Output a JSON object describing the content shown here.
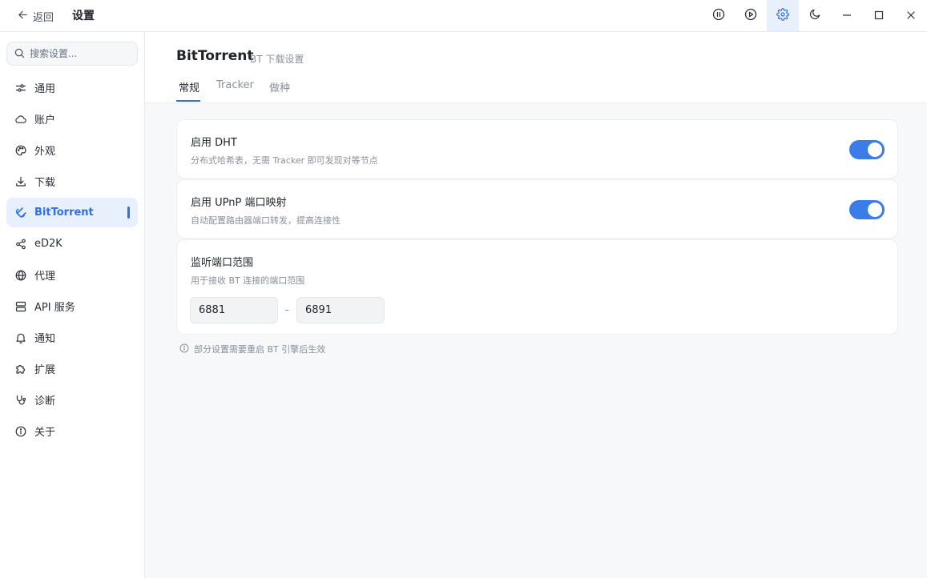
{
  "titlebar": {
    "back_label": "返回",
    "title": "设置",
    "active_button": "settings",
    "buttons": [
      "pause",
      "play",
      "settings",
      "theme-moon",
      "minimize",
      "maximize",
      "close"
    ]
  },
  "sidebar": {
    "search_placeholder": "搜索设置...",
    "items": [
      {
        "label": "通用",
        "icon": "sliders-icon"
      },
      {
        "label": "账户",
        "icon": "cloud-icon"
      },
      {
        "label": "外观",
        "icon": "palette-icon"
      },
      {
        "label": "下载",
        "icon": "download-icon"
      },
      {
        "label": "BitTorrent",
        "icon": "magnet-icon",
        "active": true
      },
      {
        "label": "eD2K",
        "icon": "share-icon"
      },
      {
        "label": "代理",
        "icon": "globe-icon"
      },
      {
        "label": "API 服务",
        "icon": "server-icon"
      },
      {
        "label": "通知",
        "icon": "bell-icon"
      },
      {
        "label": "扩展",
        "icon": "puzzle-icon"
      },
      {
        "label": "诊断",
        "icon": "stethoscope-icon"
      },
      {
        "label": "关于",
        "icon": "info-icon"
      }
    ]
  },
  "main": {
    "title": "BitTorrent",
    "subtitle": "BT 下载设置",
    "tabs": [
      {
        "label": "常规",
        "active": true
      },
      {
        "label": "Tracker"
      },
      {
        "label": "做种"
      }
    ],
    "dht": {
      "title": "启用 DHT",
      "desc": "分布式哈希表，无需 Tracker 即可发现对等节点",
      "enabled": true
    },
    "upnp": {
      "title": "启用 UPnP 端口映射",
      "desc": "自动配置路由器端口转发，提高连接性",
      "enabled": true
    },
    "port_range": {
      "title": "监听端口范围",
      "desc": "用于接收 BT 连接的端口范围",
      "from": "6881",
      "separator": "–",
      "to": "6891"
    },
    "footnote": "部分设置需要重启 BT 引擎后生效"
  },
  "colors": {
    "accent": "#2f6fe0",
    "toggle_on": "#3b7de8",
    "active_bg": "#e8f0fe"
  }
}
